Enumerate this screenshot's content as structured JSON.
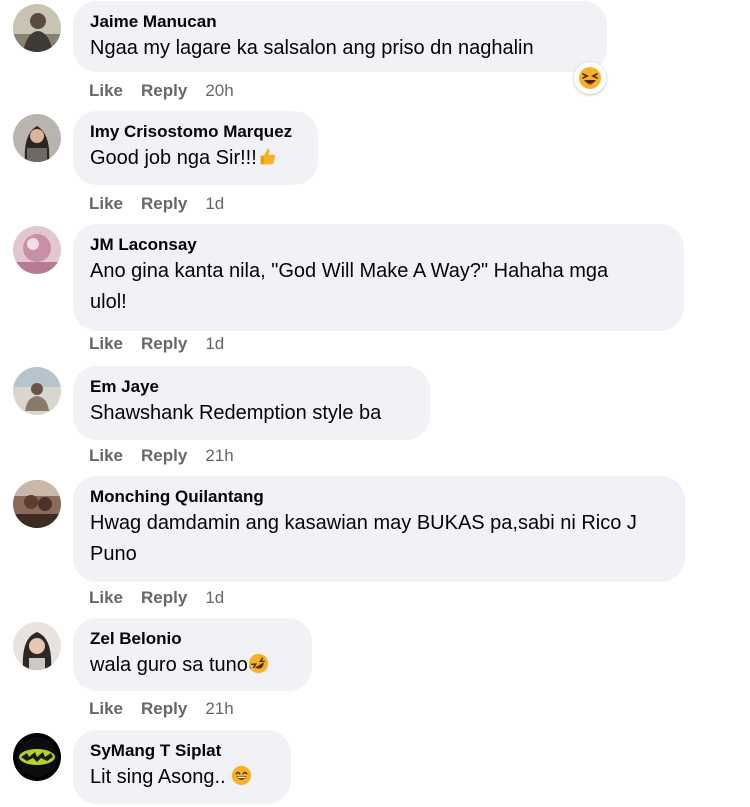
{
  "actions": {
    "like": "Like",
    "reply": "Reply"
  },
  "comments": [
    {
      "author": "Jaime Manucan",
      "text": "Ngaa my lagare ka salsalon ang priso dn naghalin",
      "time": "20h",
      "avatar": "person-avatar",
      "trailing_emoji": "",
      "reaction": "haha-reaction-icon"
    },
    {
      "author": "Imy Crisostomo Marquez",
      "text": "Good job nga Sir!!!",
      "time": "1d",
      "avatar": "person-avatar",
      "trailing_emoji": "thumbs-up-icon",
      "reaction": ""
    },
    {
      "author": "JM Laconsay",
      "text": "Ano gina kanta nila, \"God Will Make A Way?\" Hahaha mga ulol!",
      "time": "1d",
      "avatar": "person-avatar",
      "trailing_emoji": "",
      "reaction": ""
    },
    {
      "author": "Em Jaye",
      "text": "Shawshank Redemption style ba",
      "time": "21h",
      "avatar": "person-avatar",
      "trailing_emoji": "",
      "reaction": ""
    },
    {
      "author": "Monching Quilantang",
      "text": "Hwag damdamin ang kasawian may BUKAS pa,sabi ni Rico J Puno",
      "time": "1d",
      "avatar": "person-avatar",
      "trailing_emoji": "",
      "reaction": ""
    },
    {
      "author": "Zel Belonio",
      "text": "wala guro sa tuno",
      "time": "21h",
      "avatar": "person-avatar",
      "trailing_emoji": "rolling-laughing-icon",
      "reaction": ""
    },
    {
      "author": "SyMang T Siplat",
      "text": "Lit sing Asong..",
      "time": "",
      "avatar": "logo-avatar",
      "trailing_emoji": "grinning-face-icon",
      "reaction": ""
    }
  ],
  "colors": {
    "bubble": "#f0f2f5",
    "meta": "#65676b",
    "text": "#050505",
    "emoji_yellow": "#f7b125"
  }
}
